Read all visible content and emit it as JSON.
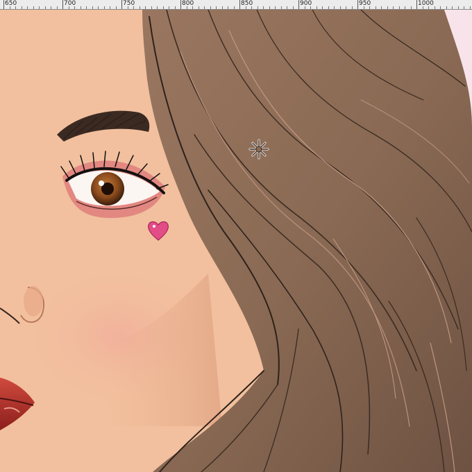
{
  "ruler": {
    "labels": [
      "650",
      "700",
      "750",
      "800",
      "850",
      "900",
      "950",
      "1000"
    ]
  },
  "canvas": {
    "subject": "face-with-hair",
    "colors": {
      "skin": "#f2c09e",
      "hair": "#8a6a54",
      "hair_dark": "#4a372b",
      "background": "#f8e3ea",
      "lips": "#b0302a",
      "iris": "#8a4a1c",
      "eyeshadow": "#d65a6a",
      "heart_gem": "#e24d86"
    }
  },
  "cursor": {
    "icon": "brush-cursor-icon"
  }
}
